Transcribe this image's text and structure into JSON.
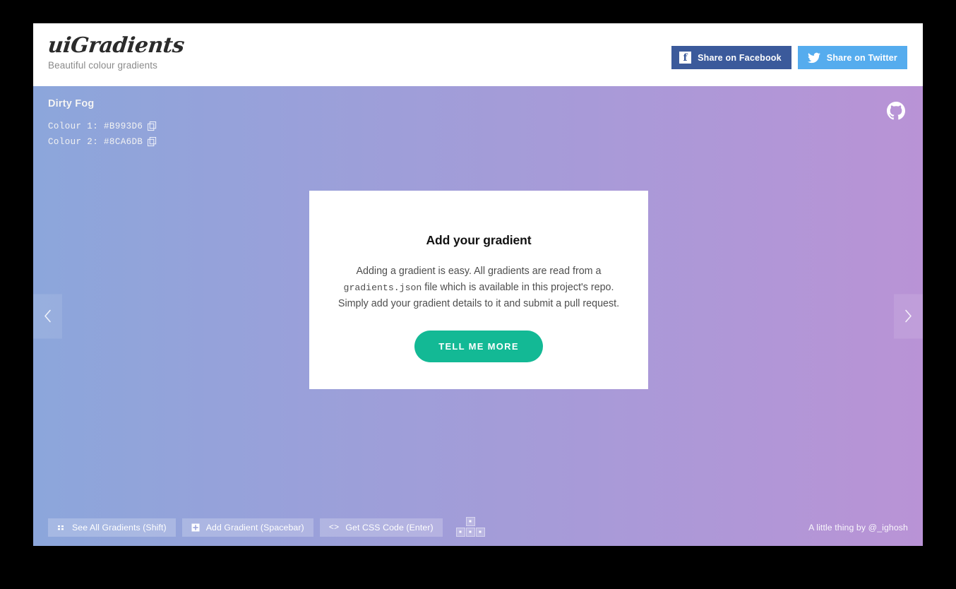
{
  "header": {
    "logo_text": "uiGradients",
    "tagline": "Beautiful colour gradients",
    "share_facebook_label": "Share on Facebook",
    "share_twitter_label": "Share on Twitter",
    "facebook_glyph": "f",
    "facebook_color": "#3B5A9B",
    "twitter_color": "#55ACEE"
  },
  "gradient": {
    "name": "Dirty Fog",
    "colour1_label": "Colour 1: #B993D6",
    "colour2_label": "Colour 2: #8CA6DB",
    "colour1_hex": "#B993D6",
    "colour2_hex": "#8CA6DB",
    "copy_icon_name": "copy-icon",
    "nav_prev_label": "‹",
    "nav_next_label": "›",
    "github_icon_name": "github-icon"
  },
  "card": {
    "title": "Add your gradient",
    "body_part1": "Adding a gradient is easy. All gradients are read from a ",
    "body_mono": "gradients.json",
    "body_part2": " file which is available in this project's repo. Simply add your gradient details to it and submit a pull request.",
    "cta_label": "TELL ME MORE",
    "cta_color": "#13B995"
  },
  "bottom_bar": {
    "see_all_label": "See All Gradients (Shift)",
    "add_gradient_label": "Add Gradient (Spacebar)",
    "get_css_label": "Get CSS Code (Enter)",
    "code_icon_text": "<>",
    "credit": "A little thing by @_ighosh"
  }
}
